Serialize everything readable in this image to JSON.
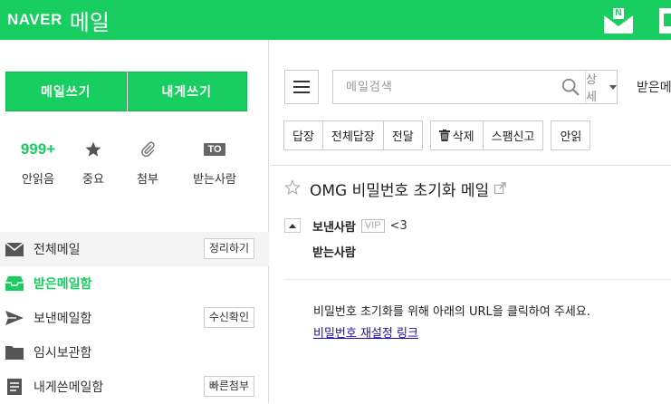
{
  "header": {
    "brand": "NAVER",
    "service": "메일",
    "colors": {
      "brand_green": "#19ce60"
    },
    "icons": [
      "naver-mail-icon",
      "app-icon"
    ]
  },
  "sidebar": {
    "compose_label": "메일쓰기",
    "self_mail_label": "내게쓰기",
    "quick": [
      {
        "value": "999+",
        "label": "안읽음"
      },
      {
        "icon": "star-icon",
        "label": "중요"
      },
      {
        "icon": "paperclip-icon",
        "label": "첨부"
      },
      {
        "icon_text": "TO",
        "label": "받는사람"
      }
    ],
    "folders": [
      {
        "label": "전체메일",
        "icon": "envelope-icon",
        "action": "정리하기"
      },
      {
        "label": "받은메일함",
        "icon": "inbox-icon"
      },
      {
        "label": "보낸메일함",
        "icon": "send-icon",
        "action": "수신확인"
      },
      {
        "label": "임시보관함",
        "icon": "folder-icon"
      },
      {
        "label": "내게쓴메일함",
        "icon": "note-icon",
        "action": "빠른첨부"
      }
    ]
  },
  "main": {
    "search": {
      "placeholder": "메일검색",
      "detail_label": "상세"
    },
    "tab_partial": "받은메",
    "toolbar": {
      "reply": "답장",
      "reply_all": "전체답장",
      "forward": "전달",
      "delete": "삭제",
      "spam": "스팸신고",
      "safe": "안읽"
    },
    "mail": {
      "subject": "OMG 비밀번호 초기화 메일",
      "sender_label": "보낸사람",
      "vip": "VIP",
      "sender": "<3",
      "recipient_label": "받는사람",
      "body": "비밀번호 초기화를 위해 아래의 URL을 클릭하여 주세요.",
      "link_text": "비밀번호 재설정 링크"
    }
  }
}
